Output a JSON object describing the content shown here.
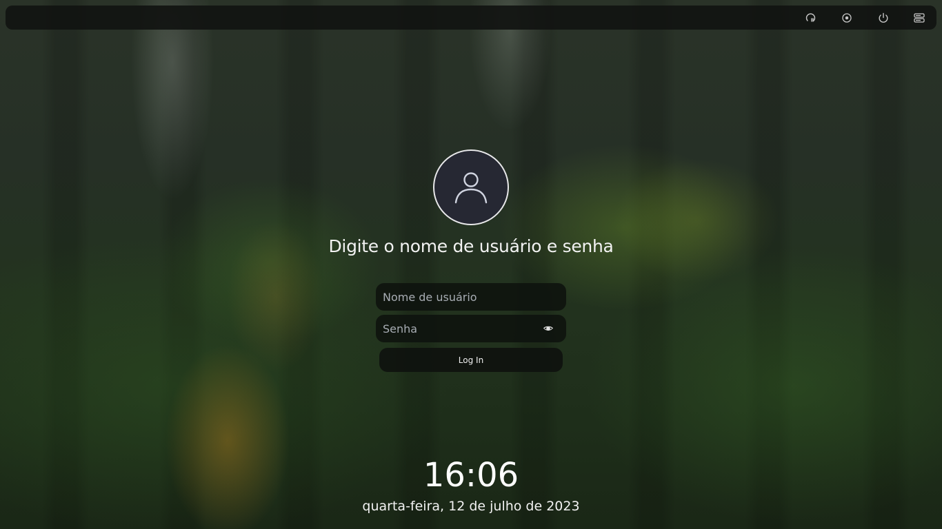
{
  "topbar": {
    "icons": [
      {
        "name": "accessibility-icon"
      },
      {
        "name": "session-options-icon"
      },
      {
        "name": "power-icon"
      },
      {
        "name": "server-settings-icon"
      }
    ]
  },
  "login": {
    "prompt": "Digite o nome de usuário e senha",
    "username_placeholder": "Nome de usuário",
    "username_value": "",
    "password_placeholder": "Senha",
    "password_value": "",
    "button_label": "Log In"
  },
  "clock": {
    "time": "16:06",
    "date": "quarta-feira, 12 de julho de 2023"
  },
  "colors": {
    "text": "#ffffff",
    "field_bg": "#0e120e",
    "avatar_bg": "#262833"
  }
}
